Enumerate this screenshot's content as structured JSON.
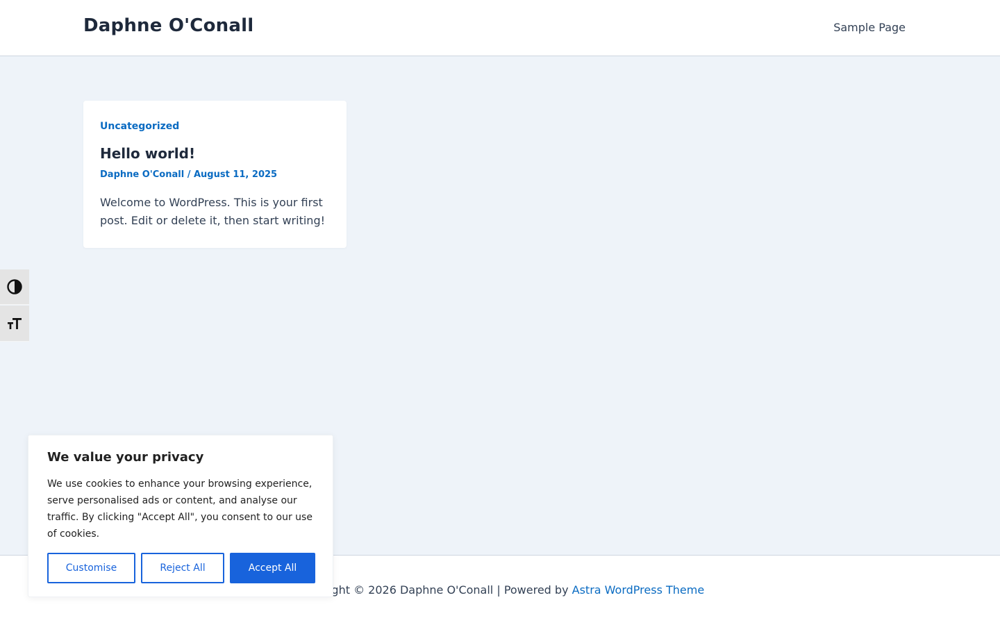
{
  "header": {
    "site_title": "Daphne O'Conall",
    "nav": [
      {
        "label": "Sample Page"
      }
    ]
  },
  "post": {
    "category": "Uncategorized",
    "title": "Hello world!",
    "author": "Daphne O'Conall",
    "separator": " / ",
    "date": "August 11, 2025",
    "excerpt": "Welcome to WordPress. This is your first post. Edit or delete it, then start writing!"
  },
  "a11y_toolbar": {
    "buttons": [
      {
        "icon": "contrast-icon"
      },
      {
        "icon": "font-size-icon"
      }
    ]
  },
  "footer": {
    "copyright_prefix": "Copyright © 2026 Daphne O'Conall | Powered by ",
    "theme_link": "Astra WordPress Theme"
  },
  "cookie_banner": {
    "title": "We value your privacy",
    "description": "We use cookies to enhance your browsing experience, serve personalised ads or content, and analyse our traffic. By clicking \"Accept All\", you consent to our use of cookies.",
    "buttons": {
      "customise": "Customise",
      "reject": "Reject All",
      "accept": "Accept All"
    }
  },
  "colors": {
    "accent": "#0a6bc2",
    "cookie_primary": "#1863dc",
    "page_bg": "#eef3f9"
  }
}
